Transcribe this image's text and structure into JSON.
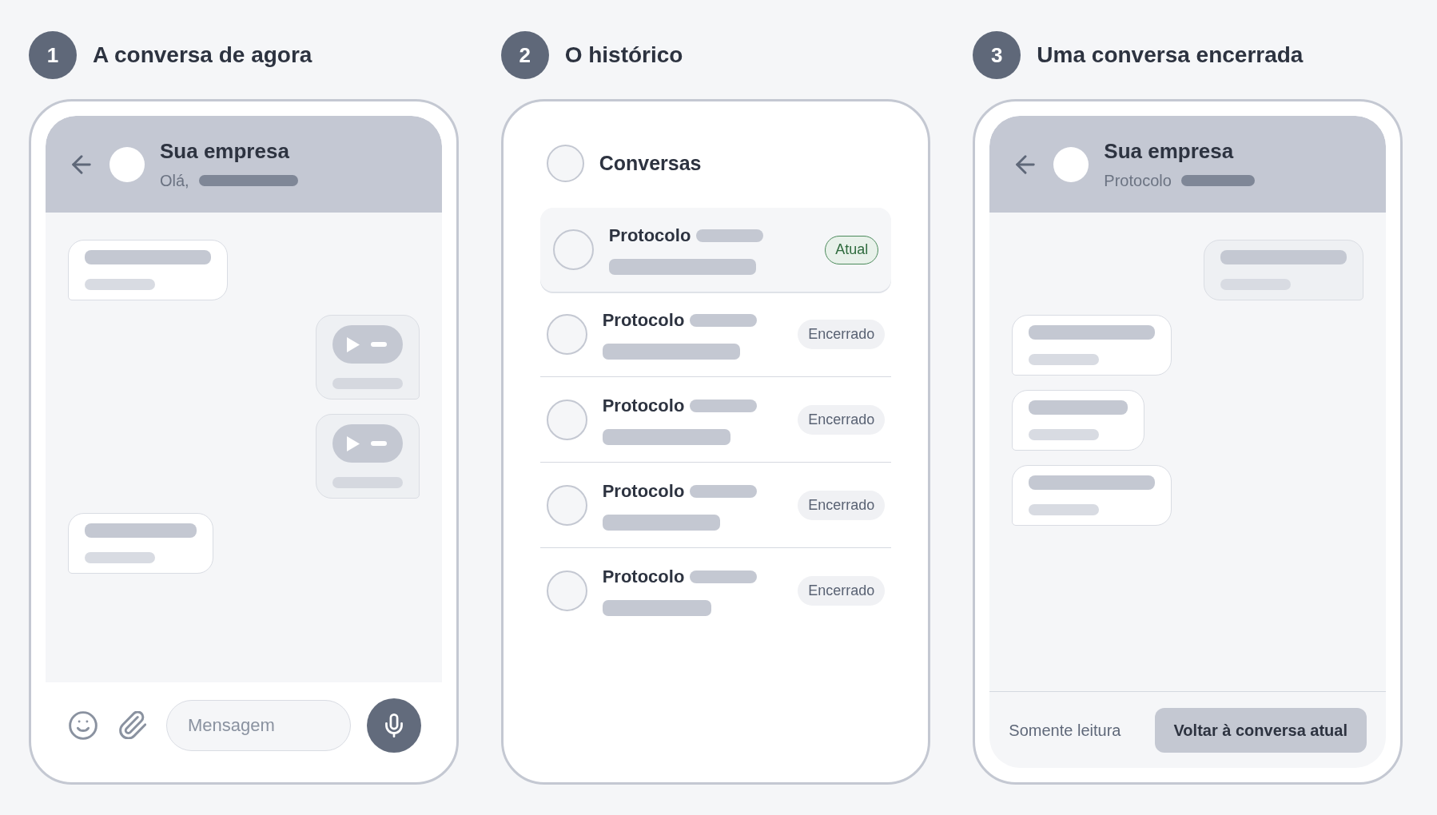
{
  "panels": [
    {
      "kind": "chat",
      "step": "1",
      "title": "A conversa de agora",
      "header": {
        "title": "Sua empresa",
        "subtitle": "Olá,"
      },
      "messages": [
        {
          "kind": "text",
          "outgoing": false
        },
        {
          "kind": "audio",
          "outgoing": true
        },
        {
          "kind": "audio",
          "outgoing": true
        },
        {
          "kind": "text",
          "outgoing": false
        }
      ],
      "composer": {
        "placeholder": "Mensagem"
      }
    },
    {
      "kind": "history",
      "step": "2",
      "title": "O histórico",
      "heading": "Conversas",
      "items": [
        {
          "label": "Protocolo",
          "selected": true,
          "status": {
            "text": "Atual",
            "kind": "current"
          }
        },
        {
          "label": "Protocolo",
          "selected": false,
          "status": {
            "text": "Encerrado",
            "kind": "closed"
          }
        },
        {
          "label": "Protocolo",
          "selected": false,
          "status": {
            "text": "Encerrado",
            "kind": "closed"
          }
        },
        {
          "label": "Protocolo",
          "selected": false,
          "status": {
            "text": "Encerrado",
            "kind": "closed"
          }
        },
        {
          "label": "Protocolo",
          "selected": false,
          "status": {
            "text": "Encerrado",
            "kind": "closed"
          }
        }
      ]
    },
    {
      "kind": "archived",
      "step": "3",
      "title": "Uma conversa encerrada",
      "header": {
        "title": "Sua empresa",
        "subtitle": "Protocolo"
      },
      "messages": [
        {
          "kind": "text",
          "outgoing": true
        },
        {
          "kind": "text",
          "outgoing": false
        },
        {
          "kind": "text",
          "outgoing": false
        },
        {
          "kind": "text",
          "outgoing": false
        }
      ],
      "footer": {
        "note": "Somente leitura",
        "button": "Voltar à conversa atual"
      }
    }
  ]
}
